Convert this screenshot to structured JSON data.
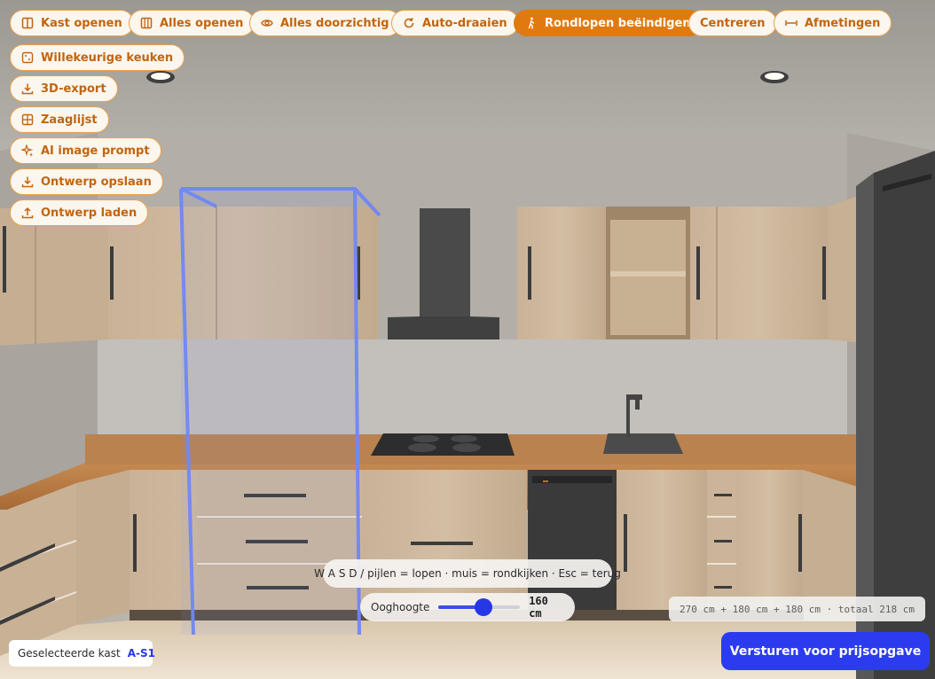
{
  "toolbar": {
    "open_cabinet": "Kast openen",
    "open_all": "Alles openen",
    "all_transparent": "Alles doorzichtig",
    "auto_rotate": "Auto-draaien",
    "end_walkthrough": "Rondlopen beëindigen",
    "center": "Centreren",
    "dimensions": "Afmetingen",
    "random_kitchen": "Willekeurige keuken",
    "export_3d": "3D-export",
    "cut_list": "Zaaglijst",
    "ai_prompt": "AI image prompt",
    "save_design": "Ontwerp opslaan",
    "load_design": "Ontwerp laden"
  },
  "icons": {
    "open_cabinet": "cabinet-doors-icon",
    "open_all": "columns-icon",
    "all_transparent": "eye-icon",
    "auto_rotate": "rotate-icon",
    "end_walkthrough": "walking-person-icon",
    "dimensions": "ruler-arrows-icon",
    "random_kitchen": "dice-icon",
    "export_3d": "download-icon",
    "cut_list": "grid-icon",
    "ai_prompt": "sparkle-icon",
    "save_design": "download-icon",
    "load_design": "upload-icon"
  },
  "hint": "W A S D / pijlen = lopen · muis = rondkijken · Esc = terug",
  "eye_height": {
    "label": "Ooghoogte",
    "value_text": "160 cm",
    "fraction": 0.55
  },
  "dimensions_readout": "270 cm + 180 cm + 180 cm · totaal 218 cm",
  "selected": {
    "label": "Geselecteerde kast",
    "code": "A-S1"
  },
  "submit_label": "Versturen voor prijsopgave",
  "colors": {
    "accent": "#e07a10",
    "accent_text": "#c2650e",
    "primary": "#2b3cf0",
    "selection_outline": "#6f86f5"
  }
}
